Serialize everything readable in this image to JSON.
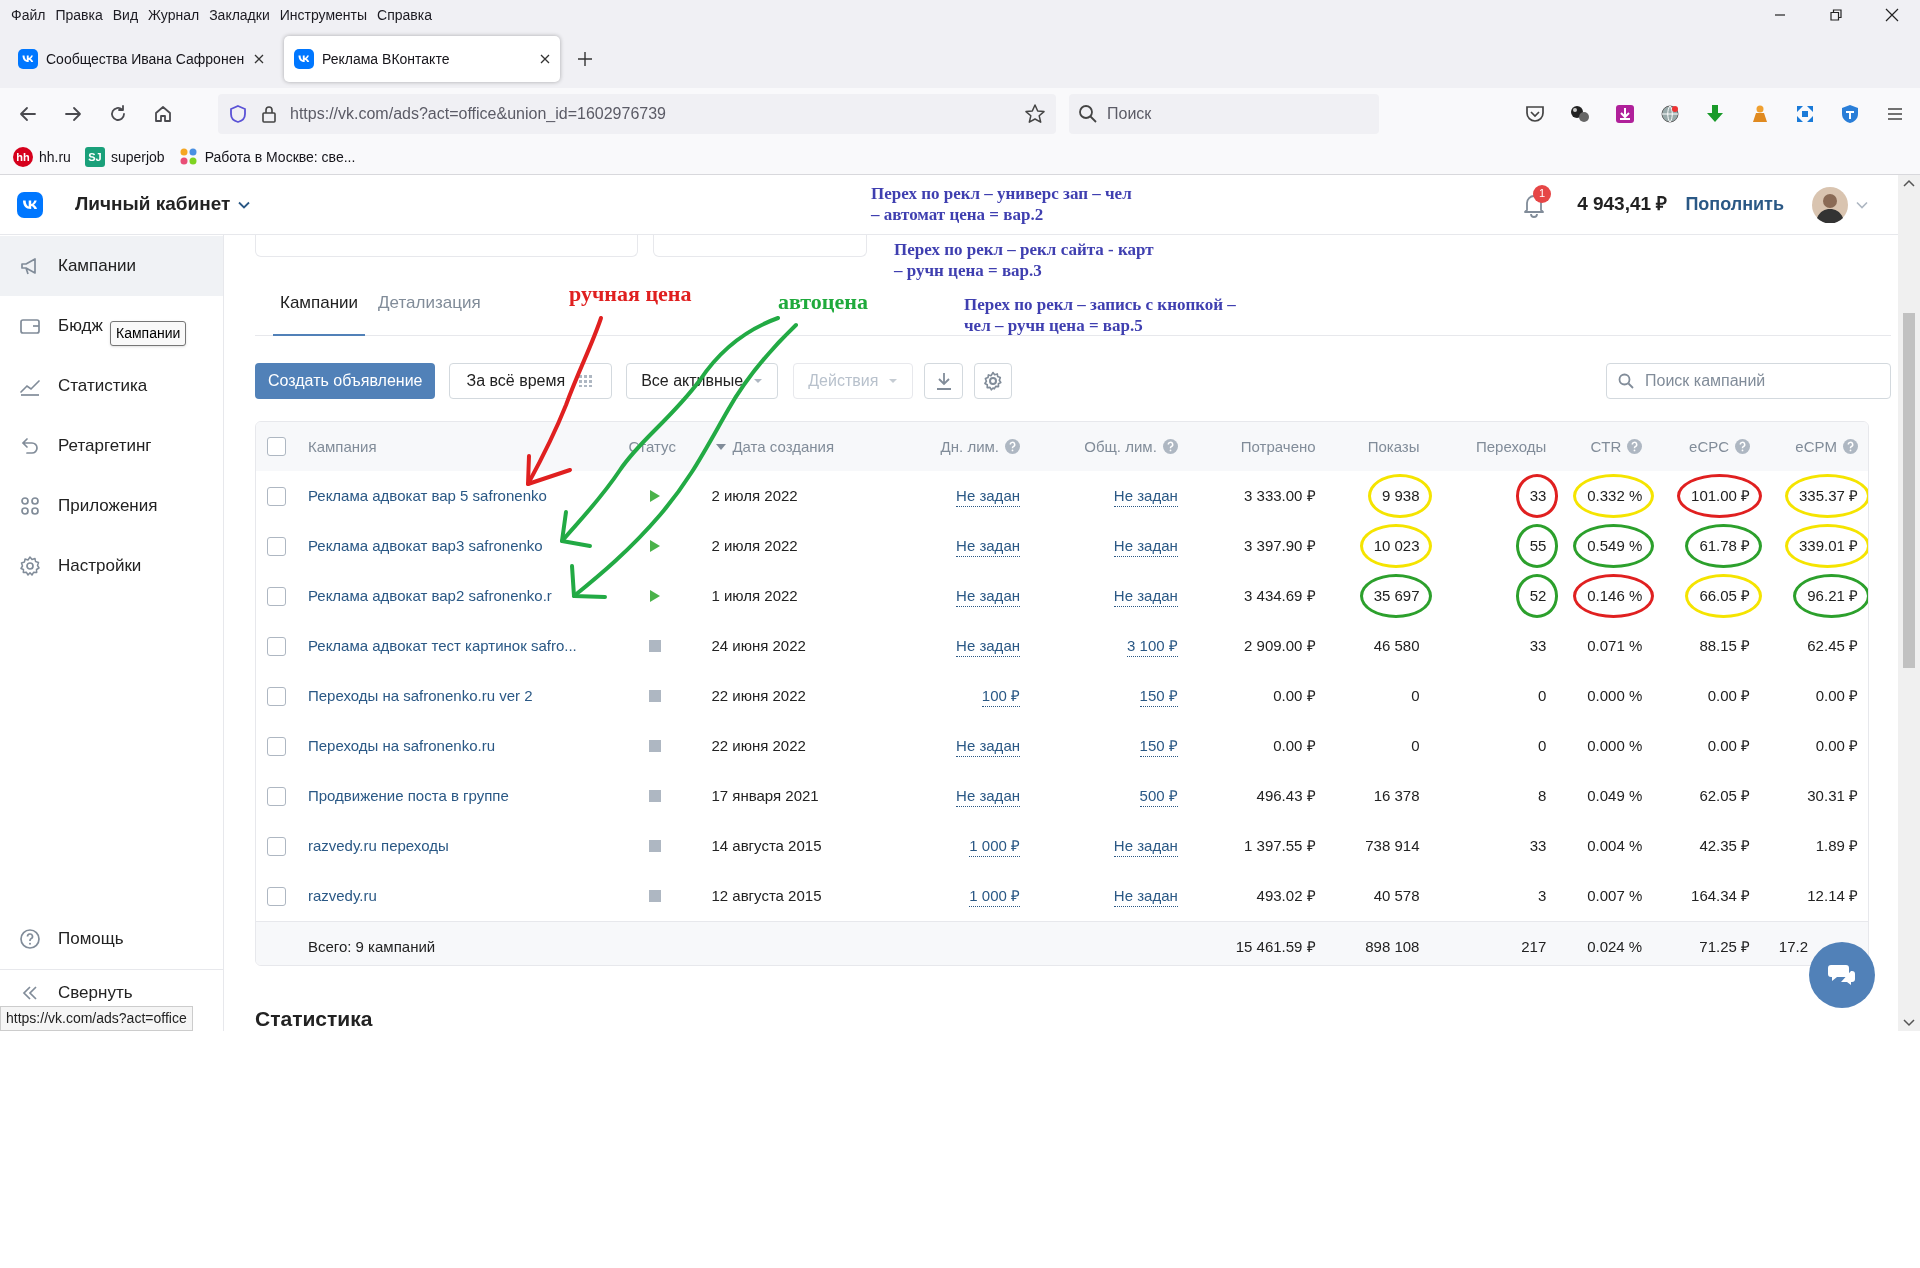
{
  "menu_bar": [
    "Файл",
    "Правка",
    "Вид",
    "Журнал",
    "Закладки",
    "Инструменты",
    "Справка"
  ],
  "browser_tabs": [
    {
      "title": "Сообщества Ивана Сафронен",
      "selected": false
    },
    {
      "title": "Реклама ВКонтакте",
      "selected": true
    }
  ],
  "address_bar": {
    "url": "https://vk.com/ads?act=office&union_id=1602976739"
  },
  "search_bar": {
    "placeholder": "Поиск"
  },
  "bookmarks": [
    {
      "badge": "hh",
      "label": "hh.ru",
      "kind": "hh"
    },
    {
      "badge": "SJ",
      "label": "superjob",
      "kind": "sj"
    },
    {
      "label": "Работа в Москве: све...",
      "kind": "dots"
    }
  ],
  "header": {
    "title": "Личный кабинет",
    "notifications": "1",
    "balance": "4 943,41 ₽",
    "top_up": "Пополнить"
  },
  "sidebar": {
    "items": [
      {
        "label": "Кампании",
        "kind": "megaphone",
        "selected": true
      },
      {
        "label": "Бюдж",
        "kind": "wallet",
        "selected": false
      },
      {
        "label": "Статистика",
        "kind": "chart",
        "selected": false
      },
      {
        "label": "Ретаргетинг",
        "kind": "retarget",
        "selected": false
      },
      {
        "label": "Приложения",
        "kind": "apps",
        "selected": false
      },
      {
        "label": "Настройки",
        "kind": "settings",
        "selected": false
      }
    ],
    "footer_items": [
      {
        "label": "Помощь",
        "kind": "help"
      },
      {
        "label": "Свернуть",
        "kind": "collapse"
      }
    ]
  },
  "tooltip": "Кампании",
  "tabs": [
    {
      "label": "Кампании",
      "selected": true
    },
    {
      "label": "Детализация",
      "selected": false
    }
  ],
  "toolbar": {
    "create": "Создать объявление",
    "period": "За всё время",
    "filter": "Все активные",
    "actions": {
      "label": "Действия",
      "disabled": true
    },
    "search": {
      "placeholder": "Поиск кампаний"
    }
  },
  "table": {
    "select_all": {
      "checked": false
    },
    "columns": [
      {
        "label": "Кампания",
        "help": false,
        "sorted": false
      },
      {
        "label": "Статус",
        "help": false,
        "sorted": false
      },
      {
        "label": "Дата создания",
        "help": false,
        "sorted": true
      },
      {
        "label": "Дн. лим.",
        "help": true,
        "sorted": false
      },
      {
        "label": "Общ. лим.",
        "help": true,
        "sorted": false
      },
      {
        "label": "Потрачено",
        "help": false,
        "sorted": false
      },
      {
        "label": "Показы",
        "help": false,
        "sorted": false
      },
      {
        "label": "Переходы",
        "help": false,
        "sorted": false
      },
      {
        "label": "CTR",
        "help": true,
        "sorted": false
      },
      {
        "label": "eCPC",
        "help": true,
        "sorted": false
      },
      {
        "label": "eCPM",
        "help": true,
        "sorted": false
      }
    ],
    "rows": [
      {
        "checked": false,
        "name": "Реклама адвокат вар 5 safronenko",
        "running": true,
        "date": "2 июля 2022",
        "day_limit": "Не задан",
        "total_limit": "Не задан",
        "spent": "3 333.00 ₽",
        "impressions": "9 938",
        "clicks": "33",
        "ctr": "0.332 %",
        "ecpc": "101.00 ₽",
        "ecpm": "335.37 ₽",
        "circles": {
          "impressions": {
            "color": "#f5e400"
          },
          "clicks": {
            "color": "#e02020"
          },
          "ctr": {
            "color": "#f5e400"
          },
          "ecpc": {
            "color": "#e02020"
          },
          "ecpm": {
            "color": "#f5e400"
          }
        }
      },
      {
        "checked": false,
        "name": "Реклама адвокат вар3 safronenko",
        "running": true,
        "date": "2 июля 2022",
        "day_limit": "Не задан",
        "total_limit": "Не задан",
        "spent": "3 397.90 ₽",
        "impressions": "10 023",
        "clicks": "55",
        "ctr": "0.549 %",
        "ecpc": "61.78 ₽",
        "ecpm": "339.01 ₽",
        "circles": {
          "impressions": {
            "color": "#f5e400"
          },
          "clicks": {
            "color": "#2ca02c"
          },
          "ctr": {
            "color": "#2ca02c"
          },
          "ecpc": {
            "color": "#2ca02c"
          },
          "ecpm": {
            "color": "#f5e400"
          }
        }
      },
      {
        "checked": false,
        "name": "Реклама адвокат вар2 safronenko.r",
        "running": true,
        "date": "1 июля 2022",
        "day_limit": "Не задан",
        "total_limit": "Не задан",
        "spent": "3 434.69 ₽",
        "impressions": "35 697",
        "clicks": "52",
        "ctr": "0.146 %",
        "ecpc": "66.05 ₽",
        "ecpm": "96.21 ₽",
        "circles": {
          "impressions": {
            "color": "#2ca02c"
          },
          "clicks": {
            "color": "#2ca02c"
          },
          "ctr": {
            "color": "#e02020"
          },
          "ecpc": {
            "color": "#f5e400"
          },
          "ecpm": {
            "color": "#2ca02c"
          }
        }
      },
      {
        "checked": false,
        "name": "Реклама адвокат тест картинок safro...",
        "running": false,
        "date": "24 июня 2022",
        "day_limit": "Не задан",
        "total_limit": "3 100 ₽",
        "spent": "2 909.00 ₽",
        "impressions": "46 580",
        "clicks": "33",
        "ctr": "0.071 %",
        "ecpc": "88.15 ₽",
        "ecpm": "62.45 ₽"
      },
      {
        "checked": false,
        "name": "Переходы на safronenko.ru ver 2",
        "running": false,
        "date": "22 июня 2022",
        "day_limit": "100 ₽",
        "total_limit": "150 ₽",
        "spent": "0.00 ₽",
        "impressions": "0",
        "clicks": "0",
        "ctr": "0.000 %",
        "ecpc": "0.00 ₽",
        "ecpm": "0.00 ₽"
      },
      {
        "checked": false,
        "name": "Переходы на safronenko.ru",
        "running": false,
        "date": "22 июня 2022",
        "day_limit": "Не задан",
        "total_limit": "150 ₽",
        "spent": "0.00 ₽",
        "impressions": "0",
        "clicks": "0",
        "ctr": "0.000 %",
        "ecpc": "0.00 ₽",
        "ecpm": "0.00 ₽"
      },
      {
        "checked": false,
        "name": "Продвижение поста в группе",
        "running": false,
        "date": "17 января 2021",
        "day_limit": "Не задан",
        "total_limit": "500 ₽",
        "spent": "496.43 ₽",
        "impressions": "16 378",
        "clicks": "8",
        "ctr": "0.049 %",
        "ecpc": "62.05 ₽",
        "ecpm": "30.31 ₽"
      },
      {
        "checked": false,
        "name": "razvedy.ru переходы",
        "running": false,
        "date": "14 августа 2015",
        "day_limit": "1 000 ₽",
        "total_limit": "Не задан",
        "spent": "1 397.55 ₽",
        "impressions": "738 914",
        "clicks": "33",
        "ctr": "0.004 %",
        "ecpc": "42.35 ₽",
        "ecpm": "1.89 ₽"
      },
      {
        "checked": false,
        "name": "razvedy.ru",
        "running": false,
        "date": "12 августа 2015",
        "day_limit": "1 000 ₽",
        "total_limit": "Не задан",
        "spent": "493.02 ₽",
        "impressions": "40 578",
        "clicks": "3",
        "ctr": "0.007 %",
        "ecpc": "164.34 ₽",
        "ecpm": "12.14 ₽"
      }
    ],
    "footer": {
      "label": "Всего: 9 кампаний",
      "spent": "15 461.59 ₽",
      "impressions": "898 108",
      "clicks": "217",
      "ctr": "0.024 %",
      "ecpc": "71.25 ₽",
      "ecpm": "17.2"
    }
  },
  "section_title": "Статистика",
  "status_link": "https://vk.com/ads?act=office",
  "annotations": [
    {
      "kind": "note",
      "text": "Перех по рекл – универс зап – чел\n– автомат цена = вар.2",
      "color": "#3f3fb0"
    },
    {
      "kind": "note",
      "text": "Перех по рекл – рекл сайта - карт\n– ручн цена = вар.3",
      "color": "#3f3fb0"
    },
    {
      "kind": "label",
      "text": "ручная цена",
      "color": "#e02020"
    },
    {
      "kind": "label",
      "text": "автоцена",
      "color": "#1faa3c"
    },
    {
      "kind": "note",
      "text": "Перех по рекл – запись с кнопкой –\nчел – ручн цена = вар.5",
      "color": "#3f3fb0"
    }
  ]
}
